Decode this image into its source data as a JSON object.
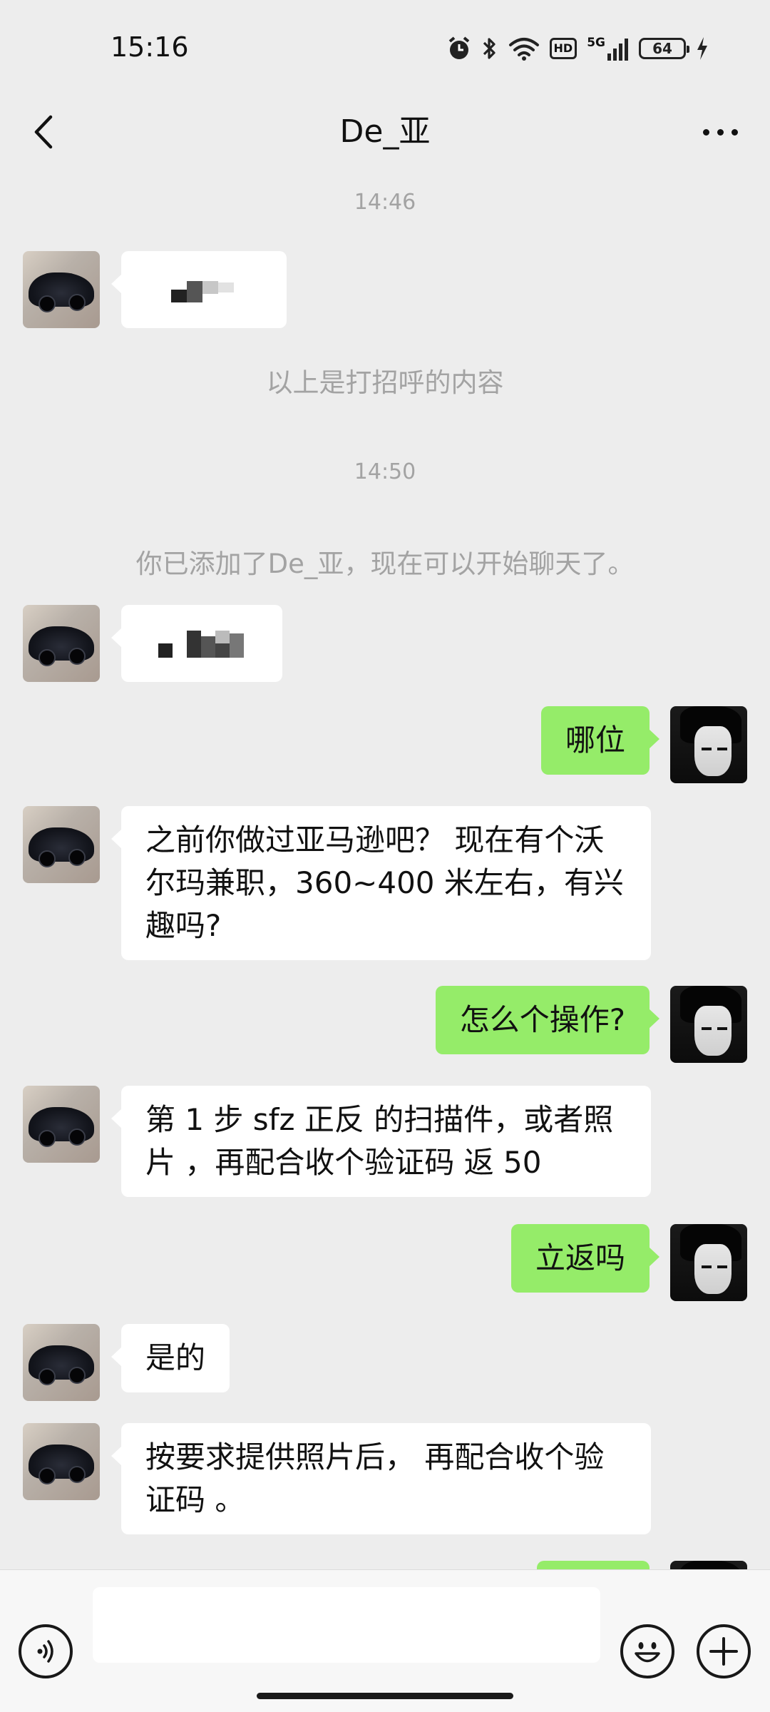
{
  "status_bar": {
    "time": "15:16",
    "network": "5G",
    "hd": "HD",
    "battery": "64",
    "icons": [
      "alarm-icon",
      "bluetooth-icon",
      "wifi-icon",
      "hd-icon",
      "signal-icon",
      "battery-icon",
      "charging-icon"
    ]
  },
  "header": {
    "title": "De_亚",
    "back_icon": "chevron-left-icon",
    "more_icon": "more-icon"
  },
  "chat": {
    "timestamps": [
      "14:46",
      "14:50"
    ],
    "notices": [
      "以上是打招呼的内容",
      "你已添加了De_亚，现在可以开始聊天了。"
    ],
    "messages": [
      {
        "from": "peer",
        "text": ""
      },
      {
        "from": "peer",
        "text": ""
      },
      {
        "from": "self",
        "text": "哪位"
      },
      {
        "from": "peer",
        "text": "之前你做过亚马逊吧？ 现在有个沃尔玛兼职，360~400 米左右，有兴趣吗?"
      },
      {
        "from": "self",
        "text": "怎么个操作?"
      },
      {
        "from": "peer",
        "text": "第 1 步  sfz 正反 的扫描件，或者照片 ，再配合收个验证码 返 50"
      },
      {
        "from": "self",
        "text": "立返吗"
      },
      {
        "from": "peer",
        "text": "是的"
      },
      {
        "from": "peer",
        "text": "按要求提供照片后，  再配合收个验证码 。"
      }
    ]
  },
  "input_bar": {
    "voice_icon": "voice-icon",
    "emoji_icon": "emoji-icon",
    "plus_icon": "plus-icon",
    "value": ""
  }
}
